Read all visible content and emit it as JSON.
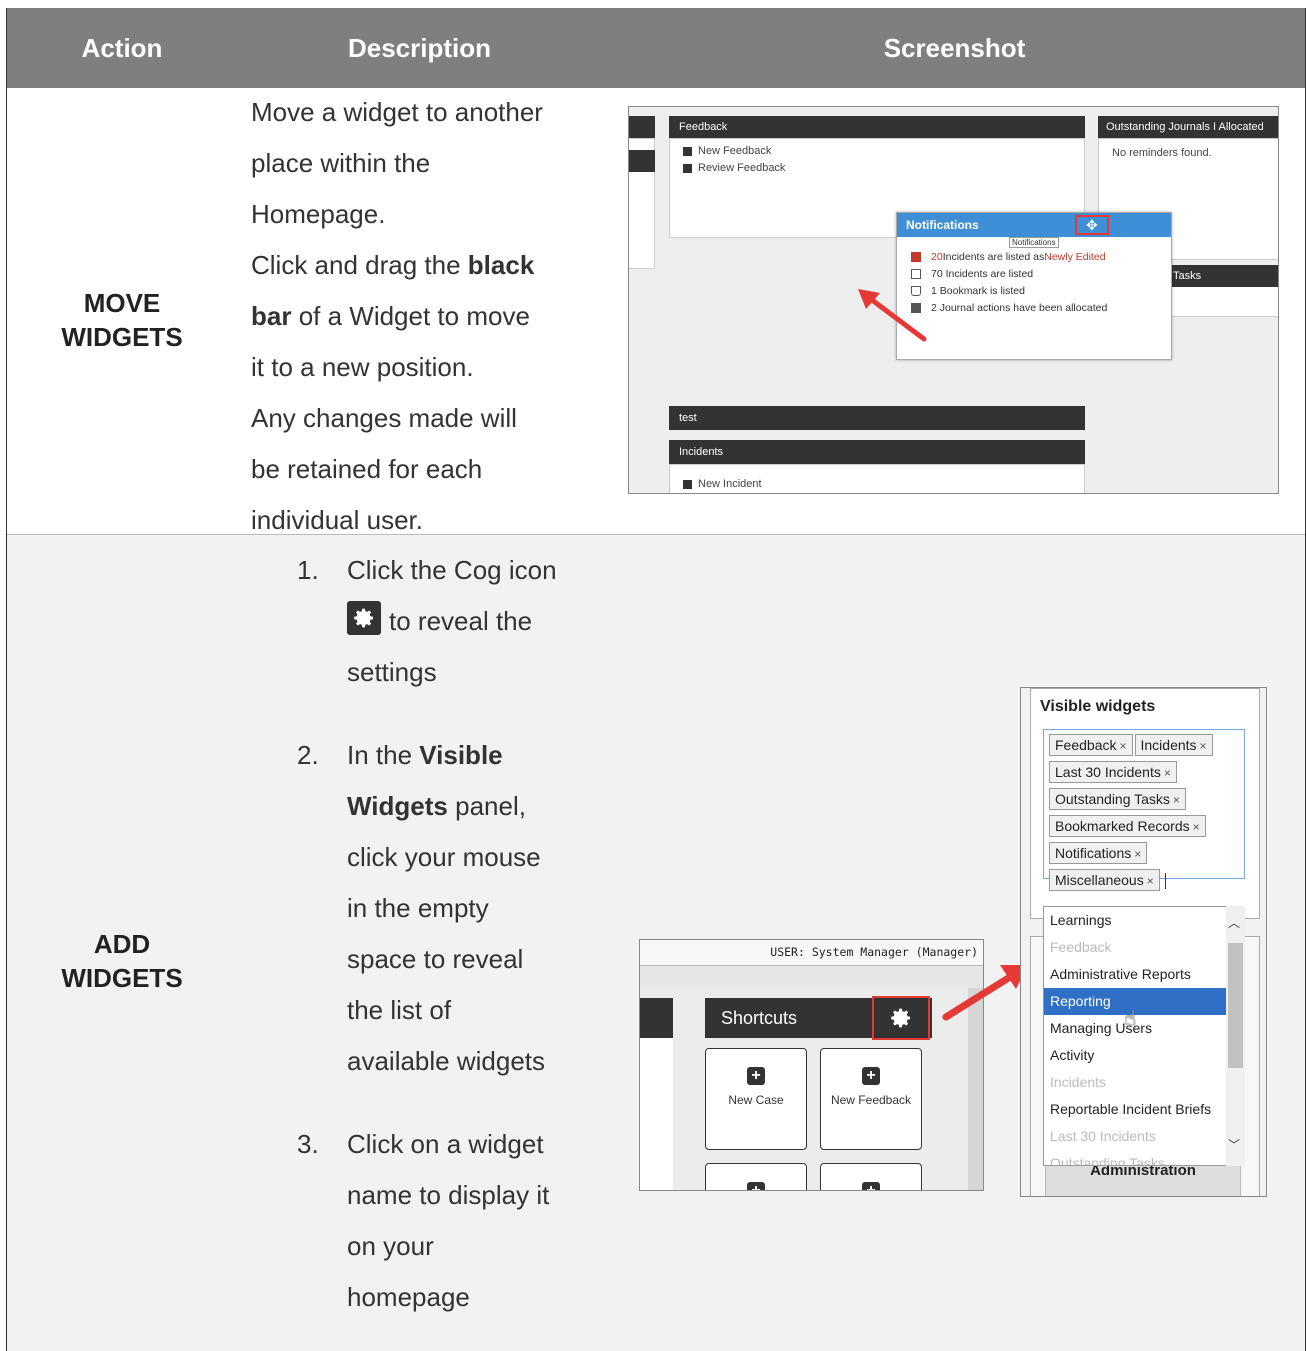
{
  "header": {
    "action": "Action",
    "description": "Description",
    "screenshot": "Screenshot"
  },
  "row1": {
    "action_line1": "MOVE",
    "action_line2": "WIDGETS",
    "desc": {
      "l1": "Move a widget to another",
      "l2": "place within the",
      "l3": "Homepage.",
      "l4a": "Click and drag the ",
      "l4b": "black",
      "l5a": "bar",
      "l5b": " of a Widget to move",
      "l6": "it to a new position.",
      "l7": "Any changes made will",
      "l8": "be retained for each",
      "l9": "individual user."
    },
    "shot": {
      "feedback_title": "Feedback",
      "new_feedback": "New Feedback",
      "review_feedback": "Review Feedback",
      "outstanding_title": "Outstanding Journals I Allocated",
      "no_reminders": "No reminders found.",
      "notifications_title": "Notifications",
      "notifications_tooltip": "Notifications",
      "n1a": "20",
      "n1b": " Incidents are listed as ",
      "n1c": "Newly Edited",
      "n2": "70 Incidents are listed",
      "n3": "1 Bookmark is listed",
      "n4": "2 Journal actions have been allocated",
      "tasks_title": "Tasks",
      "test_title": "test",
      "incidents_title": "Incidents",
      "new_incident": "New Incident"
    }
  },
  "row2": {
    "action_line1": "ADD",
    "action_line2": "WIDGETS",
    "steps": {
      "s1_num": "1.",
      "s1_a": "Click the Cog icon",
      "s1_b": "to reveal the",
      "s1_c": "settings",
      "s2_num": "2.",
      "s2_a": "In the ",
      "s2_b": "Visible",
      "s2_c": "Widgets",
      "s2_d": " panel,",
      "s2_e": "click your mouse",
      "s2_f": "in the empty",
      "s2_g": "space to reveal",
      "s2_h": "the list of",
      "s2_i": "available widgets",
      "s3_num": "3.",
      "s3_a": "Click on a widget",
      "s3_b": "name to display it",
      "s3_c": "on your",
      "s3_d": "homepage"
    },
    "shot_a": {
      "user_label": "USER: System Manager (Manager)",
      "shortcuts": "Shortcuts",
      "tile1": "New Case",
      "tile2": "New Feedback"
    },
    "shot_b": {
      "title": "Visible widgets",
      "chips": [
        "Feedback",
        "Incidents",
        "Last 30 Incidents",
        "Outstanding Tasks",
        "Bookmarked Records",
        "Notifications",
        "Miscellaneous"
      ],
      "chip_x": "×",
      "dropdown": [
        "Learnings",
        "Feedback",
        "Administrative Reports",
        "Reporting",
        "Managing Users",
        "Activity",
        "Incidents",
        "Reportable Incident Briefs",
        "Last 30 Incidents",
        "Outstanding Tasks"
      ],
      "footer": "Administration"
    }
  },
  "colors": {
    "header_bg": "#7f7f7f",
    "row2_bg": "#f2f2f2",
    "widget_bar": "#333333",
    "notif_bar": "#3f8fd6",
    "selected": "#2f6fc6",
    "highlight_red": "#e53935"
  }
}
